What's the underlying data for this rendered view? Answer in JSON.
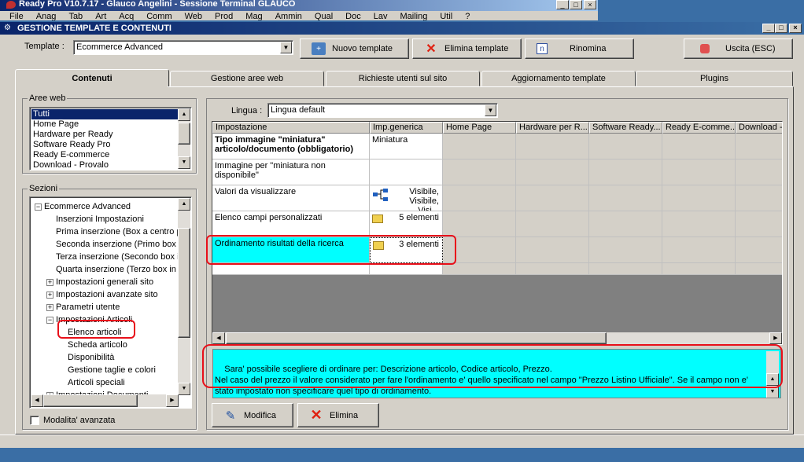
{
  "parent": {
    "title": "Ready Pro V10.7.17 - Glauco Angelini - Sessione Terminal GLAUCO",
    "menu": [
      "File",
      "Anag",
      "Tab",
      "Art",
      "Acq",
      "Comm",
      "Web",
      "Prod",
      "Mag",
      "Ammin",
      "Qual",
      "Doc",
      "Lav",
      "Mailing",
      "Util",
      "?"
    ]
  },
  "window": {
    "title": "GESTIONE TEMPLATE E CONTENUTI",
    "controls": {
      "minimize": "_",
      "maximize": "□",
      "close": "×"
    }
  },
  "toolbar": {
    "template_label": "Template :",
    "template_value": "Ecommerce Advanced",
    "new_label": "Nuovo template",
    "delete_label": "Elimina template",
    "rename_label": "Rinomina",
    "exit_label": "Uscita (ESC)"
  },
  "tabs": [
    "Contenuti",
    "Gestione aree web",
    "Richieste utenti sul sito",
    "Aggiornamento template",
    "Plugins"
  ],
  "aree_web": {
    "legend": "Aree web",
    "items": [
      "Tutti",
      "Home Page",
      "Hardware per Ready",
      "Software Ready Pro",
      "Ready E-commerce",
      "Download - Provalo"
    ]
  },
  "sezioni": {
    "legend": "Sezioni",
    "root": "Ecommerce Advanced",
    "items": [
      {
        "label": "Inserzioni Impostazioni",
        "level": 1,
        "expander": ""
      },
      {
        "label": "Prima inserzione (Box a centro pa",
        "level": 1,
        "expander": ""
      },
      {
        "label": "Seconda inserzione (Primo box in",
        "level": 1,
        "expander": ""
      },
      {
        "label": "Terza inserzione (Secondo box in",
        "level": 1,
        "expander": ""
      },
      {
        "label": "Quarta inserzione (Terzo box in b",
        "level": 1,
        "expander": ""
      },
      {
        "label": "Impostazioni generali sito",
        "level": 1,
        "expander": "+"
      },
      {
        "label": "Impostazioni avanzate sito",
        "level": 1,
        "expander": "+"
      },
      {
        "label": "Parametri utente",
        "level": 1,
        "expander": "+"
      },
      {
        "label": "Impostazioni Articoli",
        "level": 1,
        "expander": "-"
      },
      {
        "label": "Elenco articoli",
        "level": 2,
        "expander": ""
      },
      {
        "label": "Scheda articolo",
        "level": 2,
        "expander": ""
      },
      {
        "label": "Disponibilità",
        "level": 2,
        "expander": ""
      },
      {
        "label": "Gestione taglie e colori",
        "level": 2,
        "expander": ""
      },
      {
        "label": "Articoli speciali",
        "level": 2,
        "expander": ""
      },
      {
        "label": "Impostazioni Documenti",
        "level": 1,
        "expander": "+"
      }
    ]
  },
  "modalita": "Modalita' avanzata",
  "lingua": {
    "label": "Lingua :",
    "value": "Lingua default"
  },
  "grid": {
    "headers": [
      "Impostazione",
      "Imp.generica",
      "Home Page",
      "Hardware per R...",
      "Software Ready...",
      "Ready E-comme...",
      "Download -"
    ],
    "rows": [
      {
        "name": "Tipo immagine \"miniatura\" articolo/documento (obbligatorio)",
        "value": "Miniatura",
        "bold": true
      },
      {
        "name": "Immagine per \"miniatura non disponibile\"",
        "value": ""
      },
      {
        "name": "Valori da visualizzare",
        "value": "Visibile, Visibile, Visi..."
      },
      {
        "name": "Elenco campi personalizzati",
        "value": "5 elementi"
      },
      {
        "name": "Ordinamento risultati della ricerca",
        "value": "3 elementi"
      }
    ]
  },
  "description": "Sara' possibile scegliere di ordinare per: Descrizione articolo, Codice articolo, Prezzo.\nNel caso del prezzo il valore considerato per fare l'ordinamento e' quello specificato nel campo \"Prezzo Listino Ufficiale\". Se il campo non e' stato impostato non specificare quel tipo di ordinamento.",
  "actions": {
    "edit_label": "Modifica",
    "delete_label": "Elimina"
  },
  "colors": {
    "accent": "#0a246a",
    "highlight": "#00ffff",
    "annotation": "#e8101a"
  }
}
